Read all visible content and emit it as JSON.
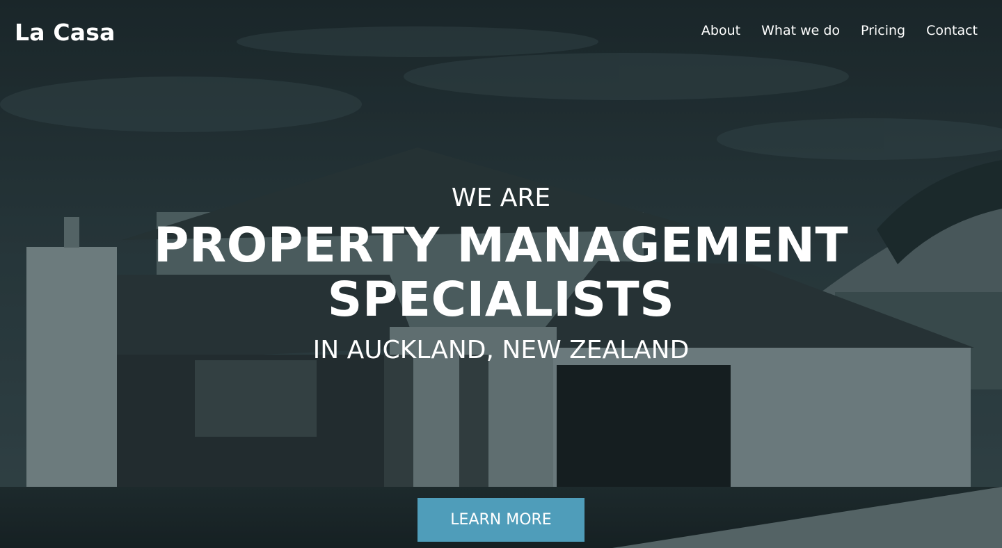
{
  "brand": {
    "name": "La Casa"
  },
  "nav": {
    "items": [
      {
        "label": "About"
      },
      {
        "label": "What we do"
      },
      {
        "label": "Pricing"
      },
      {
        "label": "Contact"
      }
    ]
  },
  "hero": {
    "pretitle": "WE ARE",
    "title_line1": "PROPERTY MANAGEMENT",
    "title_line2": "SPECIALISTS",
    "subtitle": "IN AUCKLAND, NEW ZEALAND",
    "cta_label": "LEARN MORE"
  },
  "colors": {
    "overlay": "#2c4247",
    "accent": "#4f9dba",
    "text": "#ffffff"
  }
}
